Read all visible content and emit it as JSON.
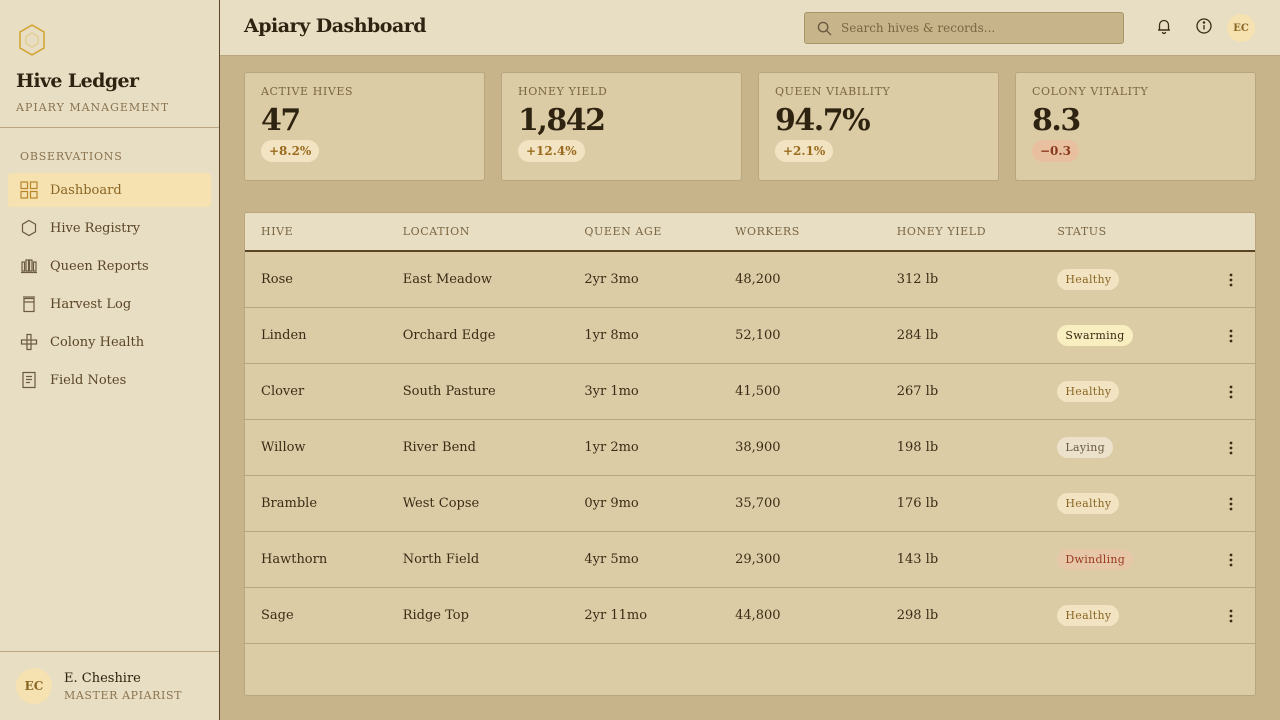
{
  "brand": {
    "name": "Hive Ledger",
    "subtitle": "APIARY MANAGEMENT"
  },
  "sidebar": {
    "section_title": "OBSERVATIONS",
    "items": [
      {
        "label": "Dashboard",
        "icon": "grid-icon",
        "active": true
      },
      {
        "label": "Hive Registry",
        "icon": "hexagon-icon"
      },
      {
        "label": "Queen Reports",
        "icon": "crown-icon"
      },
      {
        "label": "Harvest Log",
        "icon": "jar-icon"
      },
      {
        "label": "Colony Health",
        "icon": "health-cross-icon"
      },
      {
        "label": "Field Notes",
        "icon": "notes-icon"
      }
    ]
  },
  "user": {
    "initials": "EC",
    "name": "E. Cheshire",
    "role": "MASTER APIARIST"
  },
  "header": {
    "title": "Apiary Dashboard",
    "search_placeholder": "Search hives & records...",
    "avatar_initials": "EC"
  },
  "stats": [
    {
      "label": "ACTIVE HIVES",
      "value": "47",
      "delta": "+8.2%",
      "trend": "up"
    },
    {
      "label": "HONEY YIELD",
      "value": "1,842",
      "delta": "+12.4%",
      "trend": "up"
    },
    {
      "label": "QUEEN VIABILITY",
      "value": "94.7%",
      "delta": "+2.1%",
      "trend": "up"
    },
    {
      "label": "COLONY VITALITY",
      "value": "8.3",
      "delta": "−0.3",
      "trend": "down"
    }
  ],
  "table": {
    "columns": [
      "HIVE",
      "LOCATION",
      "QUEEN AGE",
      "WORKERS",
      "HONEY YIELD",
      "STATUS"
    ],
    "rows": [
      {
        "hive": "Rose",
        "location": "East Meadow",
        "queen_age": "2yr 3mo",
        "workers": "48,200",
        "yield": "312 lb",
        "status": "Healthy"
      },
      {
        "hive": "Linden",
        "location": "Orchard Edge",
        "queen_age": "1yr 8mo",
        "workers": "52,100",
        "yield": "284 lb",
        "status": "Swarming"
      },
      {
        "hive": "Clover",
        "location": "South Pasture",
        "queen_age": "3yr 1mo",
        "workers": "41,500",
        "yield": "267 lb",
        "status": "Healthy"
      },
      {
        "hive": "Willow",
        "location": "River Bend",
        "queen_age": "1yr 2mo",
        "workers": "38,900",
        "yield": "198 lb",
        "status": "Laying"
      },
      {
        "hive": "Bramble",
        "location": "West Copse",
        "queen_age": "0yr 9mo",
        "workers": "35,700",
        "yield": "176 lb",
        "status": "Healthy"
      },
      {
        "hive": "Hawthorn",
        "location": "North Field",
        "queen_age": "4yr 5mo",
        "workers": "29,300",
        "yield": "143 lb",
        "status": "Dwindling"
      },
      {
        "hive": "Sage",
        "location": "Ridge Top",
        "queen_age": "2yr 11mo",
        "workers": "44,800",
        "yield": "298 lb",
        "status": "Healthy"
      }
    ]
  },
  "colors": {
    "background": "#c8b48a",
    "panel": "#e8dec4",
    "accent": "#8a6624",
    "active_nav": "#f5e2b0"
  }
}
